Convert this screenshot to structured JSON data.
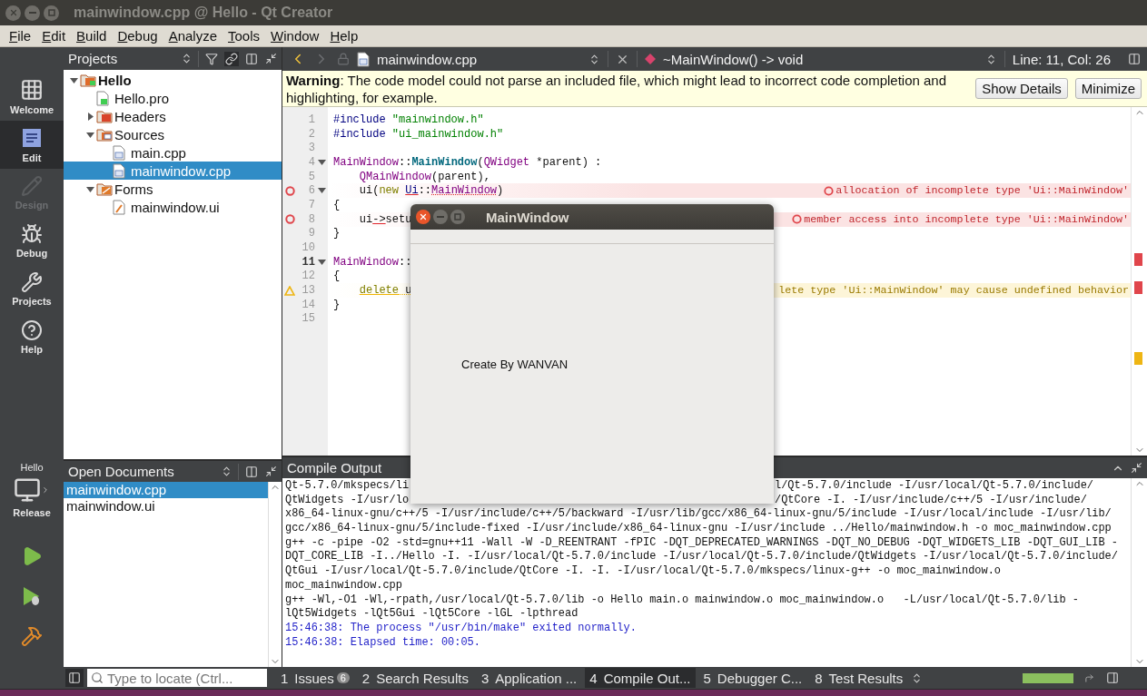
{
  "window": {
    "title": "mainwindow.cpp @ Hello - Qt Creator"
  },
  "menu": [
    "File",
    "Edit",
    "Build",
    "Debug",
    "Analyze",
    "Tools",
    "Window",
    "Help"
  ],
  "modes": [
    {
      "label": "Welcome",
      "selected": false,
      "disabled": false
    },
    {
      "label": "Edit",
      "selected": true,
      "disabled": false
    },
    {
      "label": "Design",
      "selected": false,
      "disabled": true
    },
    {
      "label": "Debug",
      "selected": false,
      "disabled": false
    },
    {
      "label": "Projects",
      "selected": false,
      "disabled": false
    },
    {
      "label": "Help",
      "selected": false,
      "disabled": false
    }
  ],
  "kit": {
    "project": "Hello",
    "build": "Release"
  },
  "projects": {
    "title": "Projects",
    "tree": [
      {
        "name": "Hello",
        "kind": "project",
        "expanded": true,
        "selected": false,
        "children": [
          {
            "name": "Hello.pro",
            "kind": "pro",
            "selected": false
          },
          {
            "name": "Headers",
            "kind": "headers",
            "expanded": false,
            "selected": false
          },
          {
            "name": "Sources",
            "kind": "sources",
            "expanded": true,
            "selected": false,
            "children": [
              {
                "name": "main.cpp",
                "kind": "cpp",
                "selected": false
              },
              {
                "name": "mainwindow.cpp",
                "kind": "cpp",
                "selected": true
              }
            ]
          },
          {
            "name": "Forms",
            "kind": "forms",
            "expanded": true,
            "selected": false,
            "children": [
              {
                "name": "mainwindow.ui",
                "kind": "ui",
                "selected": false
              }
            ]
          }
        ]
      }
    ]
  },
  "open_documents": {
    "title": "Open Documents",
    "items": [
      {
        "name": "mainwindow.cpp",
        "selected": true
      },
      {
        "name": "mainwindow.ui",
        "selected": false
      }
    ]
  },
  "editor": {
    "file": "mainwindow.cpp",
    "symbol": "~MainWindow() -> void",
    "position": "Line: 11, Col: 26",
    "warning": {
      "message": "**Warning**: The code model could not parse an included file, which might lead to incorrect code completion and highlighting, for example.",
      "buttons": [
        "Show Details",
        "Minimize"
      ]
    },
    "lines": [
      {
        "number": "1",
        "kind": "plain",
        "current": false,
        "tokens": [
          {
            "text": "#include ",
            "kind": "preprocessor"
          },
          {
            "text": "\"mainwindow.h\"",
            "kind": "string"
          }
        ]
      },
      {
        "number": "2",
        "kind": "plain",
        "current": false,
        "tokens": [
          {
            "text": "#include ",
            "kind": "preprocessor"
          },
          {
            "text": "\"ui_mainwindow.h\"",
            "kind": "string"
          }
        ]
      },
      {
        "number": "3",
        "kind": "plain",
        "current": false
      },
      {
        "number": "4",
        "kind": "plain",
        "fold": true,
        "current": false,
        "tokens": [
          {
            "text": "MainWindow",
            "kind": "type"
          },
          {
            "text": "::",
            "kind": "text"
          },
          {
            "text": "MainWindow",
            "kind": "function"
          },
          {
            "text": "(",
            "kind": "text"
          },
          {
            "text": "QWidget",
            "kind": "type"
          },
          {
            "text": " *parent) :",
            "kind": "text"
          }
        ]
      },
      {
        "number": "5",
        "kind": "plain",
        "indented": true,
        "current": false,
        "tokens": [
          {
            "text": "QMainWindow",
            "kind": "type"
          },
          {
            "text": "(parent),",
            "kind": "text"
          }
        ]
      },
      {
        "number": "6",
        "kind": "error",
        "fold": true,
        "indented": true,
        "current": false,
        "tokens": [
          {
            "text": "ui(",
            "kind": "text"
          },
          {
            "text": "new ",
            "kind": "keyword"
          },
          {
            "text": "Ui",
            "kind": "error_namespace"
          },
          {
            "text": "::",
            "kind": "text"
          },
          {
            "text": "MainWindow",
            "kind": "error_type"
          },
          {
            "text": ")",
            "kind": "text"
          }
        ],
        "annotation": {
          "kind": "error",
          "text": "allocation of incomplete type 'Ui::MainWindow'"
        }
      },
      {
        "number": "7",
        "kind": "plain",
        "current": false,
        "tokens": [
          {
            "text": "{",
            "kind": "text"
          }
        ]
      },
      {
        "number": "8",
        "kind": "error",
        "indented": true,
        "current": false,
        "tokens": [
          {
            "text": "ui",
            "kind": "text"
          },
          {
            "text": "->",
            "kind": "error_text"
          },
          {
            "text": "setu",
            "kind": "text"
          }
        ],
        "annotation": {
          "kind": "error",
          "text": "member access into incomplete type 'Ui::MainWindow'"
        }
      },
      {
        "number": "9",
        "kind": "plain",
        "current": false,
        "tokens": [
          {
            "text": "}",
            "kind": "text"
          }
        ]
      },
      {
        "number": "10",
        "kind": "plain",
        "current": false
      },
      {
        "number": "11",
        "kind": "plain",
        "fold": true,
        "current": true,
        "tokens": [
          {
            "text": "MainWindow",
            "kind": "type"
          },
          {
            "text": "::",
            "kind": "text"
          }
        ]
      },
      {
        "number": "12",
        "kind": "plain",
        "current": false,
        "tokens": [
          {
            "text": "{",
            "kind": "text"
          }
        ]
      },
      {
        "number": "13",
        "kind": "warning",
        "indented": true,
        "current": false,
        "tokens": [
          {
            "text": "delete",
            "kind": "warning_keyword"
          },
          {
            "text": " u",
            "kind": "warning_text"
          }
        ],
        "annotation": {
          "kind": "warning",
          "text": "lete type 'Ui::MainWindow' may cause undefined behavior"
        }
      },
      {
        "number": "14",
        "kind": "plain",
        "current": false,
        "tokens": [
          {
            "text": "}",
            "kind": "text"
          }
        ]
      },
      {
        "number": "15",
        "kind": "plain",
        "current": false
      }
    ]
  },
  "output": {
    "title": "Compile Output",
    "lines": [
      {
        "kind": "normal",
        "text": "Qt-5.7.0/mkspecs/li",
        "text_right": "l/Qt-5.7.0/include -I/usr/local/Qt-5.7.0/include/"
      },
      {
        "kind": "normal",
        "text": "QtWidgets -I/usr/lo",
        "text_right": "/QtCore -I. -I/usr/include/c++/5 -I/usr/include/"
      },
      {
        "kind": "normal",
        "text": "x86_64-linux-gnu/c++/5 -I/usr/include/c++/5/backward -I/usr/lib/gcc/x86_64-linux-gnu/5/include -I/usr/local/include -I/usr/lib/"
      },
      {
        "kind": "normal",
        "text": "gcc/x86_64-linux-gnu/5/include-fixed -I/usr/include/x86_64-linux-gnu -I/usr/include ../Hello/mainwindow.h -o moc_mainwindow.cpp"
      },
      {
        "kind": "normal",
        "text": "g++ -c -pipe -O2 -std=gnu++11 -Wall -W -D_REENTRANT -fPIC -DQT_DEPRECATED_WARNINGS -DQT_NO_DEBUG -DQT_WIDGETS_LIB -DQT_GUI_LIB -"
      },
      {
        "kind": "normal",
        "text": "DQT_CORE_LIB -I../Hello -I. -I/usr/local/Qt-5.7.0/include -I/usr/local/Qt-5.7.0/include/QtWidgets -I/usr/local/Qt-5.7.0/include/"
      },
      {
        "kind": "normal",
        "text": "QtGui -I/usr/local/Qt-5.7.0/include/QtCore -I. -I. -I/usr/local/Qt-5.7.0/mkspecs/linux-g++ -o moc_mainwindow.o"
      },
      {
        "kind": "normal",
        "text": "moc_mainwindow.cpp"
      },
      {
        "kind": "normal",
        "text": "g++ -Wl,-O1 -Wl,-rpath,/usr/local/Qt-5.7.0/lib -o Hello main.o mainwindow.o moc_mainwindow.o   -L/usr/local/Qt-5.7.0/lib -"
      },
      {
        "kind": "normal",
        "text": "lQt5Widgets -lQt5Gui -lQt5Core -lGL -lpthread"
      },
      {
        "kind": "system",
        "text": "15:46:38: The process \"/usr/bin/make\" exited normally."
      },
      {
        "kind": "system",
        "text": "15:46:38: Elapsed time: 00:05."
      }
    ]
  },
  "locator": {
    "placeholder": "Type to locate (Ctrl..."
  },
  "panes": [
    {
      "number": "1",
      "label": "Issues",
      "badge": "6",
      "selected": false
    },
    {
      "number": "2",
      "label": "Search Results",
      "selected": false
    },
    {
      "number": "3",
      "label": "Application ...",
      "selected": false
    },
    {
      "number": "4",
      "label": "Compile Out...",
      "selected": true
    },
    {
      "number": "5",
      "label": "Debugger C...",
      "selected": false
    },
    {
      "number": "8",
      "label": "Test Results",
      "selected": false
    }
  ],
  "progress": {
    "level": 1
  },
  "dialog": {
    "title": "MainWindow",
    "label": "Create By WANVAN"
  }
}
